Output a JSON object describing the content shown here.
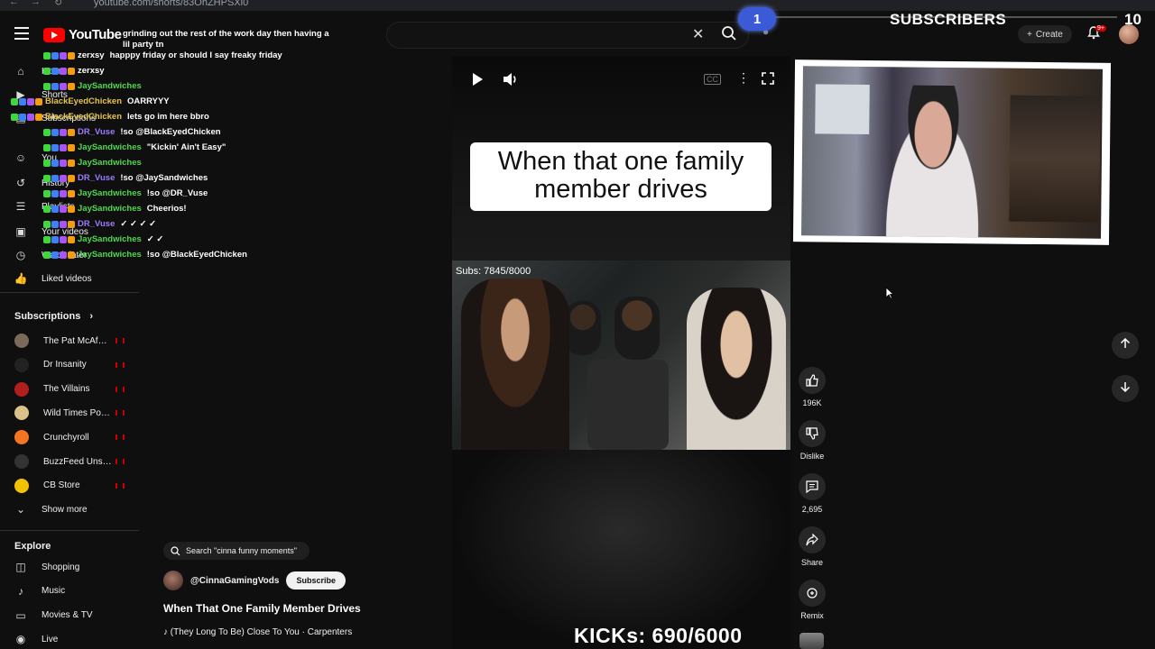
{
  "browser": {
    "url": "youtube.com/shorts/83OhZHPSXi0"
  },
  "header": {
    "logo_text": "YouTube",
    "create_label": "Create",
    "notif_badge": "9+"
  },
  "overlay": {
    "subs_current": "1",
    "subs_title": "SUBSCRIBERS",
    "subs_goal": "10",
    "kicks": "KICKs: 690/6000",
    "clip_subs": "Subs: 7845/8000"
  },
  "sidebar": {
    "top": [
      {
        "label": "Home",
        "icon": "home-icon"
      },
      {
        "label": "Shorts",
        "icon": "shorts-icon"
      },
      {
        "label": "Subscriptions",
        "icon": "subscriptions-icon"
      },
      {
        "label": "You",
        "icon": "you-icon"
      },
      {
        "label": "History",
        "icon": "history-icon"
      },
      {
        "label": "Playlists",
        "icon": "playlists-icon"
      },
      {
        "label": "Your videos",
        "icon": "your-videos-icon"
      },
      {
        "label": "Watch later",
        "icon": "watch-later-icon"
      },
      {
        "label": "Liked videos",
        "icon": "liked-videos-icon"
      }
    ],
    "subscriptions_title": "Subscriptions",
    "subscriptions": [
      {
        "label": "The Pat McAfee ...",
        "color": "#7a6a5a"
      },
      {
        "label": "Dr Insanity",
        "color": "#222222"
      },
      {
        "label": "The Villains",
        "color": "#b01e1e"
      },
      {
        "label": "Wild Times Podc...",
        "color": "#d8c28a"
      },
      {
        "label": "Crunchyroll",
        "color": "#f47521"
      },
      {
        "label": "BuzzFeed Unsolv...",
        "color": "#333333"
      },
      {
        "label": "CB Store",
        "color": "#f2c200"
      }
    ],
    "show_more": "Show more",
    "explore_title": "Explore",
    "explore": [
      {
        "label": "Shopping",
        "icon": "shopping-icon"
      },
      {
        "label": "Music",
        "icon": "music-icon"
      },
      {
        "label": "Movies & TV",
        "icon": "movies-icon"
      },
      {
        "label": "Live",
        "icon": "live-icon"
      }
    ]
  },
  "chat": [
    {
      "user": "",
      "msg": "grinding out the rest of the work day then having a",
      "color": "#ffffff"
    },
    {
      "user": "",
      "msg": "lil party tn",
      "color": "#ffffff"
    },
    {
      "user": "zerxsy",
      "msg": "happpy friday or should I say freaky friday",
      "color": "#ffffff"
    },
    {
      "user": "zerxsy",
      "msg": "",
      "color": "#ffffff"
    },
    {
      "user": "JaySandwiches",
      "msg": "",
      "color": "#4fd84f"
    },
    {
      "user": "BlackEyedChicken",
      "msg": "OARRYYY",
      "color": "#e8c547"
    },
    {
      "user": "BlackEyedChicken",
      "msg": "lets go im here bbro",
      "color": "#e8c547"
    },
    {
      "user": "DR_Vuse",
      "msg": "!so @BlackEyedChicken",
      "color": "#9b7bff"
    },
    {
      "user": "JaySandwiches",
      "msg": "\"Kickin' Ain't Easy\"",
      "color": "#4fd84f"
    },
    {
      "user": "JaySandwiches",
      "msg": "",
      "color": "#4fd84f"
    },
    {
      "user": "DR_Vuse",
      "msg": "!so @JaySandwiches",
      "color": "#9b7bff"
    },
    {
      "user": "JaySandwiches",
      "msg": "!so @DR_Vuse",
      "color": "#4fd84f"
    },
    {
      "user": "JaySandwiches",
      "msg": "Cheerios!",
      "color": "#4fd84f"
    },
    {
      "user": "DR_Vuse",
      "msg": "✓ ✓ ✓ ✓",
      "color": "#9b7bff"
    },
    {
      "user": "JaySandwiches",
      "msg": "✓ ✓",
      "color": "#4fd84f"
    },
    {
      "user": "JaySandwiches",
      "msg": "!so @BlackEyedChicken",
      "color": "#4fd84f"
    }
  ],
  "video": {
    "caption": "When that one family member drives",
    "search_pill": "Search \"cinna funny moments\"",
    "channel": "@CinnaGamingVods",
    "subscribe": "Subscribe",
    "title": "When That One Family Member Drives",
    "music": "♪ (They Long To Be) Close To You · Carpenters"
  },
  "actions": {
    "likes": "196K",
    "dislike": "Dislike",
    "comments": "2,695",
    "share": "Share",
    "remix": "Remix"
  }
}
